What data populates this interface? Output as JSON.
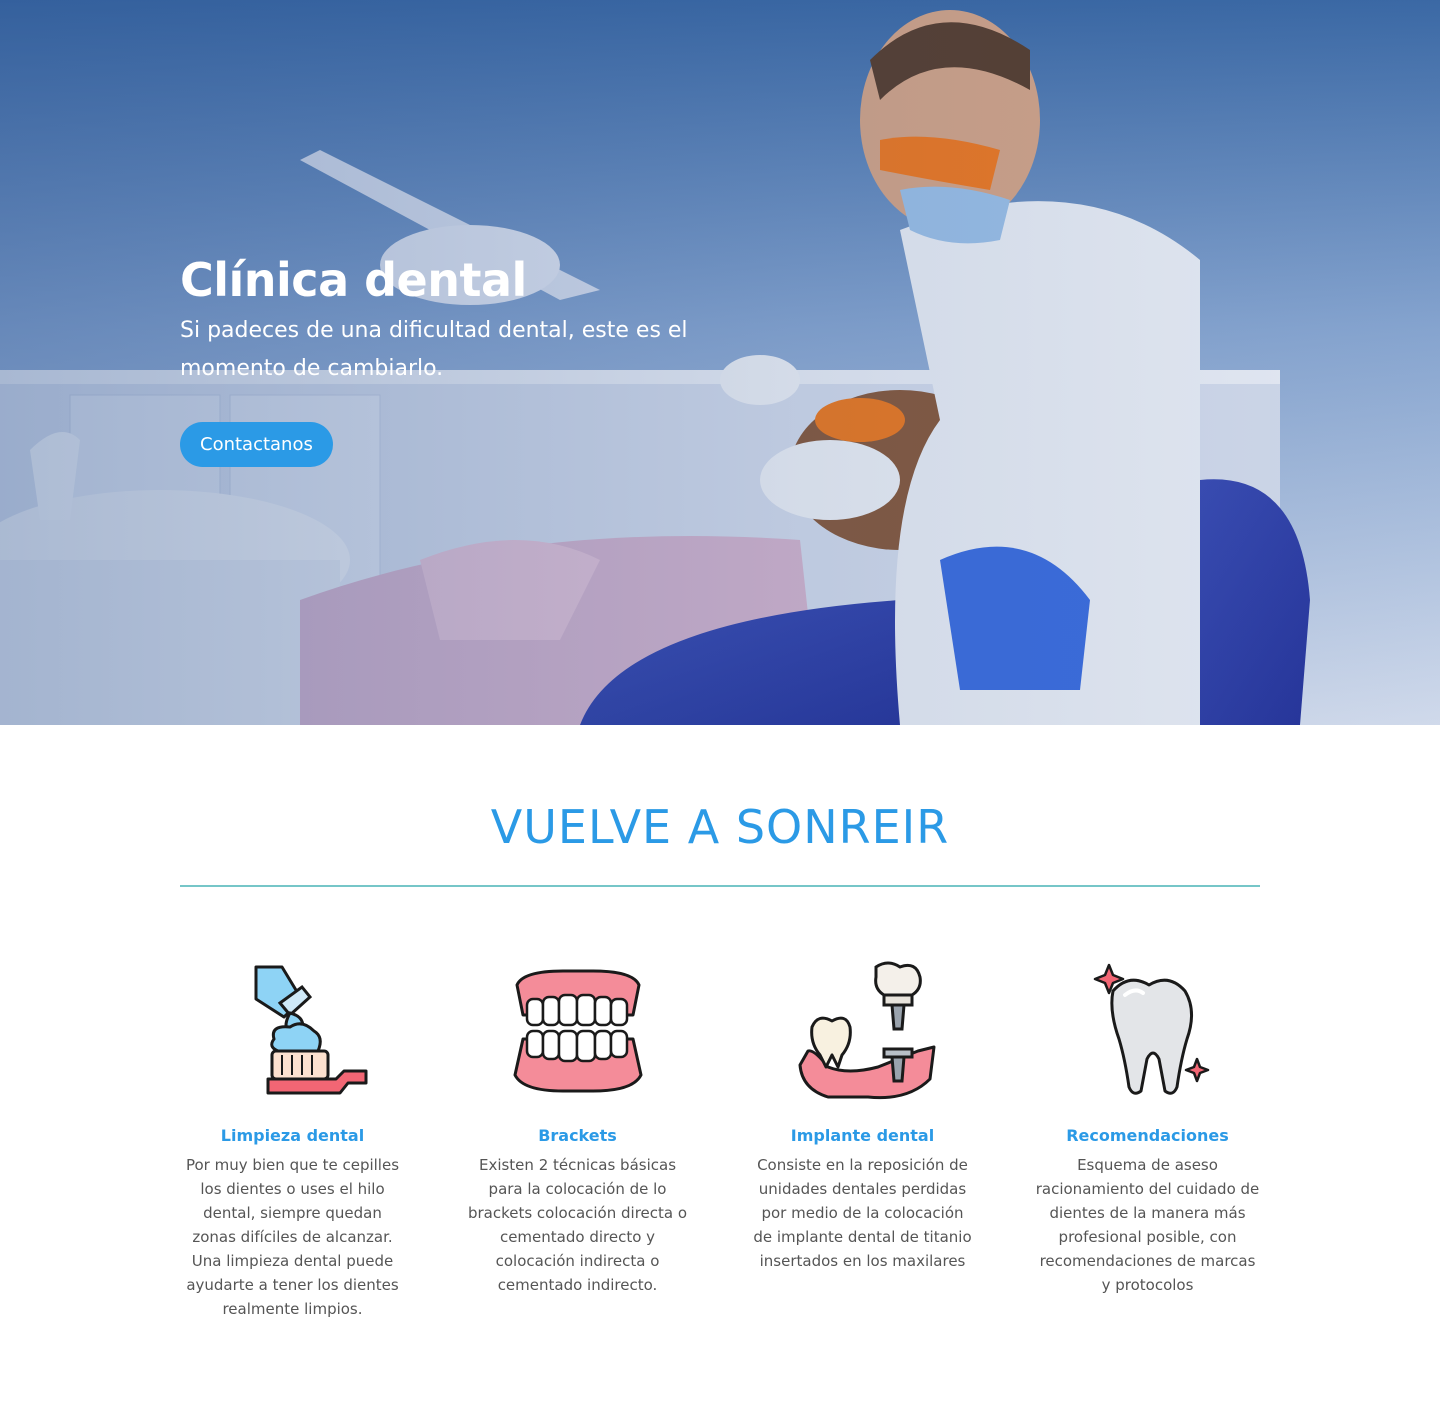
{
  "hero": {
    "title": "Clínica dental",
    "subtitle": "Si padeces de una dificultad dental, este es el momento de cambiarlo.",
    "cta_label": "Contactanos"
  },
  "section": {
    "title": "VUELVE A SONREIR"
  },
  "services": [
    {
      "icon": "toothbrush-icon",
      "title": "Limpieza dental",
      "description": "Por muy bien que te cepilles los dientes o uses el hilo dental, siempre quedan zonas difíciles de alcanzar. Una limpieza dental puede ayudarte a tener los dientes realmente limpios."
    },
    {
      "icon": "dentures-icon",
      "title": "Brackets",
      "description": "Existen 2 técnicas básicas para la colocación de lo brackets colocación directa o cementado directo y colocación indirecta o cementado indirecto."
    },
    {
      "icon": "dental-implant-icon",
      "title": "Implante dental",
      "description": "Consiste en la reposición de unidades dentales perdidas por medio de la colocación de implante dental de titanio insertados en los maxilares"
    },
    {
      "icon": "shiny-tooth-icon",
      "title": "Recomendaciones",
      "description": "Esquema de aseso racionamiento del cuidado de dientes de la manera más profesional posible, con recomendaciones de marcas y protocolos"
    }
  ],
  "colors": {
    "accent": "#2b9ae6",
    "divider": "#76c6c8",
    "text": "#555555"
  }
}
